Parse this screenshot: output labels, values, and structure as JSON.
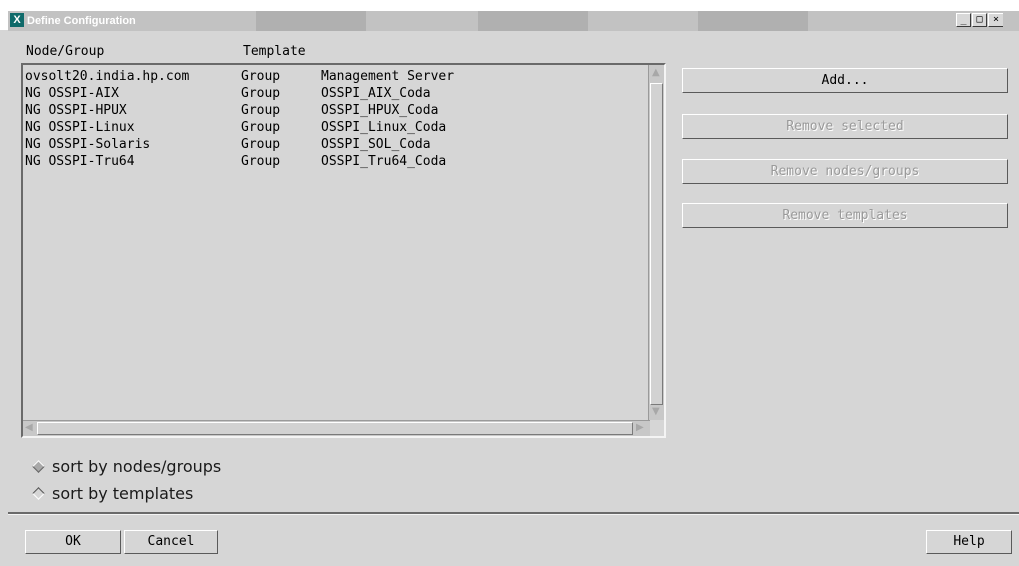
{
  "window": {
    "title": "Define Configuration",
    "app_icon_glyph": "X",
    "buttons": {
      "minimize": "_",
      "maximize": "□",
      "close": "×"
    }
  },
  "list": {
    "headers": {
      "node_group": "Node/Group",
      "template": "Template"
    },
    "rows": [
      {
        "node": "ovsolt20.india.hp.com",
        "type": "Group",
        "template": "Management Server"
      },
      {
        "node": "NG OSSPI-AIX",
        "type": "Group",
        "template": "OSSPI_AIX_Coda"
      },
      {
        "node": "NG OSSPI-HPUX",
        "type": "Group",
        "template": "OSSPI_HPUX_Coda"
      },
      {
        "node": "NG OSSPI-Linux",
        "type": "Group",
        "template": "OSSPI_Linux_Coda"
      },
      {
        "node": "NG OSSPI-Solaris",
        "type": "Group",
        "template": "OSSPI_SOL_Coda"
      },
      {
        "node": "NG OSSPI-Tru64",
        "type": "Group",
        "template": "OSSPI_Tru64_Coda"
      }
    ]
  },
  "actions": {
    "add": "Add...",
    "remove_selected": "Remove selected",
    "remove_nodes_groups": "Remove nodes/groups",
    "remove_templates": "Remove templates"
  },
  "sort": {
    "by_nodes_groups": "sort by nodes/groups",
    "by_templates": "sort by templates",
    "selected": "by_nodes_groups"
  },
  "footer": {
    "ok": "OK",
    "cancel": "Cancel",
    "help": "Help"
  },
  "colors": {
    "icon_bg": "#0f6a6a",
    "face": "#d6d6d6",
    "disabled_text": "#9a9a9a"
  }
}
